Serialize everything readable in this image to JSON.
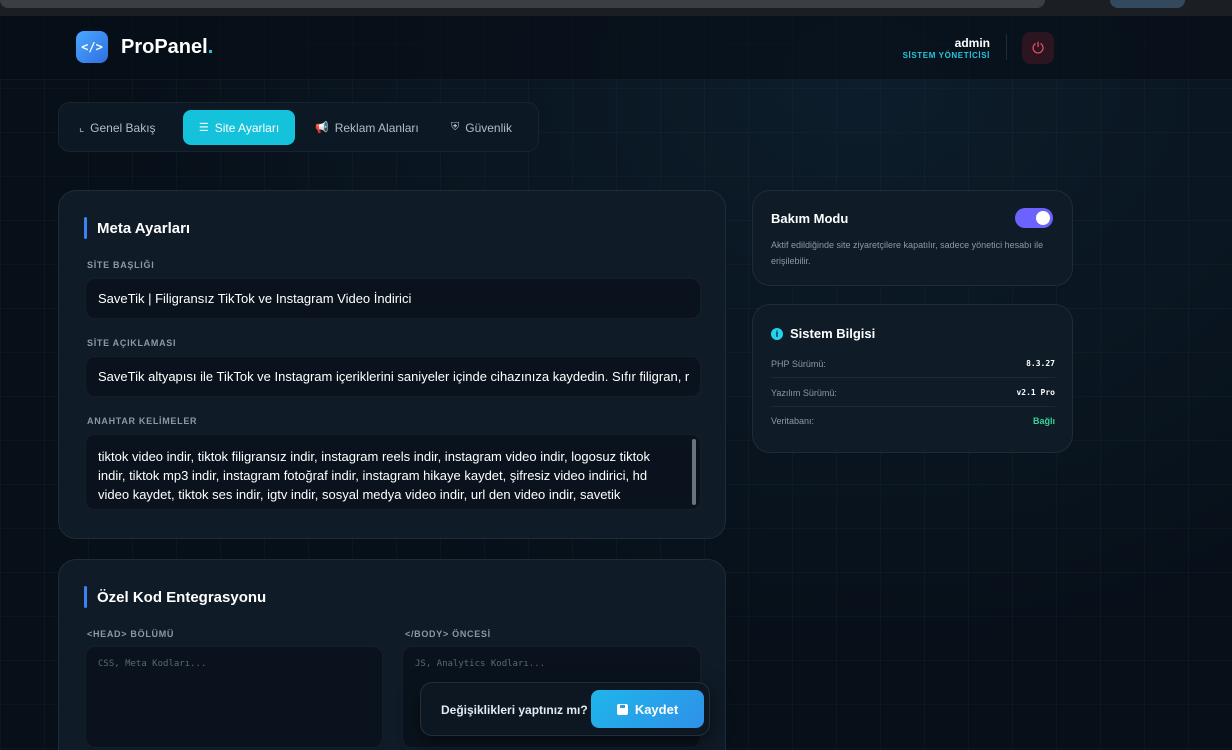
{
  "app": {
    "brand_name": "ProPanel",
    "brand_dot": ".",
    "logo_glyph": "</>"
  },
  "user": {
    "name": "admin",
    "role": "SİSTEM YÖNETİCİSİ"
  },
  "tabs": [
    {
      "label": "Genel Bakış",
      "icon": "chart-line-icon",
      "glyph": "⌞",
      "active": false
    },
    {
      "label": "Site Ayarları",
      "icon": "sliders-icon",
      "glyph": "☰",
      "active": true
    },
    {
      "label": "Reklam Alanları",
      "icon": "megaphone-icon",
      "glyph": "📢",
      "active": false
    },
    {
      "label": "Güvenlik",
      "icon": "shield-icon",
      "glyph": "⛨",
      "active": false
    }
  ],
  "meta": {
    "title": "Meta Ayarları",
    "site_title_label": "SİTE BAŞLIĞI",
    "site_title_value": "SaveTik | Filigransız TikTok ve Instagram Video İndirici",
    "site_desc_label": "SİTE AÇIKLAMASI",
    "site_desc_value": "SaveTik altyapısı ile TikTok ve Instagram içeriklerini saniyeler içinde cihazınıza kaydedin. Sıfır filigran, r",
    "keywords_label": "ANAHTAR KELİMELER",
    "keywords_value": "tiktok video indir, tiktok filigransız indir, instagram reels indir, instagram video indir, logosuz tiktok indir, tiktok mp3 indir, instagram fotoğraf indir, instagram hikaye kaydet, şifresiz video indirici, hd video kaydet, tiktok ses indir, igtv indir, sosyal medya video indir, url den video indir, savetik"
  },
  "custom_code": {
    "title": "Özel Kod Entegrasyonu",
    "head_label": "<HEAD> BÖLÜMÜ",
    "head_placeholder": "CSS, Meta Kodları...",
    "body_label": "</BODY> ÖNCESİ",
    "body_placeholder": "JS, Analytics Kodları..."
  },
  "maintenance": {
    "title": "Bakım Modu",
    "description": "Aktif edildiğinde site ziyaretçilere kapatılır, sadece yönetici hesabı ile erişilebilir.",
    "enabled": true,
    "accent_color": "#6c63ff"
  },
  "system_info": {
    "title": "Sistem Bilgisi",
    "rows": [
      {
        "label": "PHP Sürümü:",
        "value": "8.3.27"
      },
      {
        "label": "Yazılım Sürümü:",
        "value": "v2.1 Pro"
      },
      {
        "label": "Veritabanı:",
        "value": "Bağlı"
      }
    ]
  },
  "save_bar": {
    "question": "Değişiklikleri yaptınız mı?",
    "button_label": "Kaydet"
  },
  "colors": {
    "accent": "#14c2dc",
    "danger": "#ff4d6d",
    "success": "#34d399"
  }
}
